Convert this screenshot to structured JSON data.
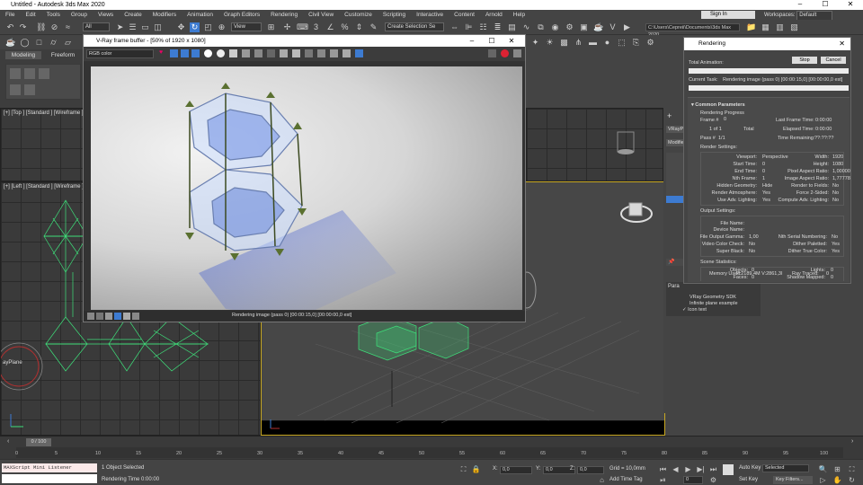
{
  "app": {
    "title": "Untitled - Autodesk 3ds Max 2020",
    "sign_in": "Sign In",
    "workspaces_label": "Workspaces:",
    "workspace_value": "Default"
  },
  "menu": [
    "File",
    "Edit",
    "Tools",
    "Group",
    "Views",
    "Create",
    "Modifiers",
    "Animation",
    "Graph Editors",
    "Rendering",
    "Civil View",
    "Customize",
    "Scripting",
    "Interactive",
    "Content",
    "Arnold",
    "Help"
  ],
  "toolbar": {
    "filter": "All",
    "view": "View",
    "selection_set": "Create Selection Se",
    "project_path": "C:\\Users\\Cepreii\\Documents\\3ds Max 2020"
  },
  "ribbon": {
    "tabs": [
      "Modeling",
      "Freeform"
    ]
  },
  "viewports": {
    "top": "[+] [Top ] [Standard ] [Wireframe ]",
    "left": "[+] [Left ] [Standard ] [Wireframe ]",
    "left_object": "ayPlane"
  },
  "vfb": {
    "title": "V-Ray frame buffer - [50% of 1920 x 1080]",
    "channel": "RGB color",
    "status": "Rendering image (pass 0) [00:00:15,0] [00:00:00,0 est]"
  },
  "render": {
    "title": "Rendering",
    "total_animation_label": "Total Animation:",
    "stop": "Stop",
    "cancel": "Cancel",
    "current_task_label": "Current Task:",
    "current_task": "Rendering image (pass 0) [00:00:15,0] [00:00:00,0 est]",
    "common_parameters": "Common Parameters",
    "rendering_progress": "Rendering Progress",
    "frame_label": "Frame #",
    "frame_value": "0",
    "of_label": "1 of 1",
    "total": "Total",
    "pass_label": "Pass #",
    "pass_value": "1/1",
    "last_frame_time_label": "Last Frame Time:",
    "last_frame_time": "0:00:00",
    "elapsed_time_label": "Elapsed Time:",
    "elapsed_time": "0:00:00",
    "time_remaining_label": "Time Remaining:",
    "time_remaining": "??:??:??",
    "render_settings": "Render Settings:",
    "rs_left": [
      [
        "Viewport:",
        "Perspective"
      ],
      [
        "Start Time:",
        "0"
      ],
      [
        "End Time:",
        "0"
      ],
      [
        "Nth Frame:",
        "1"
      ],
      [
        "Hidden Geometry:",
        "Hide"
      ],
      [
        "Render Atmosphere:",
        "Yes"
      ],
      [
        "Use Adv. Lighting:",
        "Yes"
      ]
    ],
    "rs_right": [
      [
        "Width:",
        "1920"
      ],
      [
        "Height:",
        "1080"
      ],
      [
        "Pixel Aspect Ratio:",
        "1,00000"
      ],
      [
        "Image Aspect Ratio:",
        "1,77778"
      ],
      [
        "Render to Fields:",
        "No"
      ],
      [
        "Force 2-Sided:",
        "No"
      ],
      [
        "Compute Adv. Lighting:",
        "No"
      ]
    ],
    "output_settings": "Output Settings:",
    "os_left": [
      [
        "File Name:",
        ""
      ],
      [
        "Device Name:",
        ""
      ],
      [
        "File Output Gamma:",
        "1,00"
      ],
      [
        "Video Color Check:",
        "No"
      ],
      [
        "Super Black:",
        "No"
      ]
    ],
    "os_right": [
      [
        "Nth Serial Numbering:",
        "No"
      ],
      [
        "Dither Paletted:",
        "Yes"
      ],
      [
        "Dither True Color:",
        "Yes"
      ]
    ],
    "scene_statistics": "Scene Statistics:",
    "ss_left": [
      [
        "Objects:",
        "0"
      ],
      [
        "Faces:",
        "0"
      ],
      [
        "Memory Used:",
        "P:2189,4M V:2861,3I"
      ]
    ],
    "ss_right": [
      [
        "Lights:",
        "0"
      ],
      [
        "Shadow Mapped:",
        "0"
      ],
      [
        "Ray Traced:",
        "0"
      ]
    ]
  },
  "command_panel": {
    "object_type": "VRayPlane",
    "modifier": "Modifier",
    "params": "Para",
    "sdk": "VRay Geometry SDK",
    "example": "Infinite plane example",
    "icon_text": "Icon text"
  },
  "timeline": {
    "frame": "0 / 100",
    "ticks": [
      "0",
      "5",
      "10",
      "15",
      "20",
      "25",
      "30",
      "35",
      "40",
      "45",
      "50",
      "55",
      "60",
      "65",
      "70",
      "75",
      "80",
      "85",
      "90",
      "95",
      "100"
    ]
  },
  "status": {
    "maxscript": "MAXScript Mini Listener",
    "selected": "1 Object Selected",
    "render_time": "Rendering Time  0:00:00",
    "x_label": "X:",
    "x_value": "0,0",
    "y_label": "Y:",
    "y_value": "0,0",
    "z_label": "Z:",
    "z_value": "0,0",
    "grid": "Grid = 10,0mm",
    "add_time_tag": "Add Time Tag",
    "auto_key": "Auto Key",
    "set_key": "Set Key",
    "selected_filter": "Selected",
    "key_filters": "Key Filters...",
    "current_frame": "0"
  },
  "colors": {
    "wire_green": "#3ee07a",
    "accent_blue": "#3d7bd1"
  }
}
